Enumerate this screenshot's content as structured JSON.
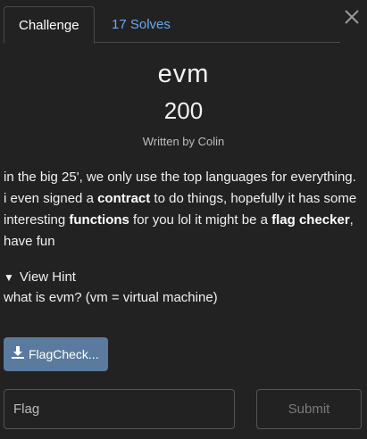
{
  "tabs": {
    "challenge_label": "Challenge",
    "solves_label": "17 Solves"
  },
  "challenge": {
    "name": "evm",
    "points": "200",
    "author": "Written by Colin",
    "description": {
      "p1": "in the big 25', we only use the top languages for everything. i even signed a ",
      "b1": "contract",
      "p2": " to do things, hopefully it has some interesting ",
      "b2": "functions",
      "p3": " for you lol it might be a ",
      "b3": "flag checker",
      "p4": ", have fun"
    }
  },
  "hint": {
    "toggle_label": "View Hint",
    "text": "what is evm? (vm = virtual machine)"
  },
  "file": {
    "label": "FlagCheck...",
    "icon": "download-icon"
  },
  "form": {
    "placeholder": "Flag",
    "submit_label": "Submit"
  },
  "icons": {
    "close": "close-icon"
  },
  "colors": {
    "background": "#222222",
    "link": "#6aa9f0",
    "file_button": "#5a7a9e"
  }
}
